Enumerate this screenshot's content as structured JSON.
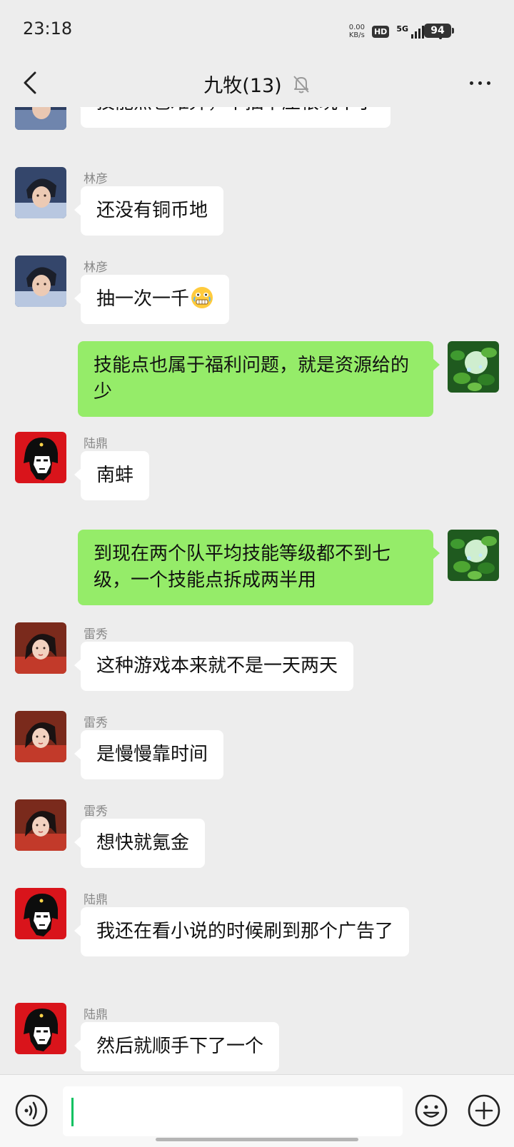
{
  "status_bar": {
    "time": "23:18",
    "net_speed_value": "0.00",
    "net_speed_unit": "KB/s",
    "hd": "HD",
    "network": "5G",
    "battery": "94"
  },
  "nav": {
    "title": "九牧(13)",
    "muted": true
  },
  "messages": [
    {
      "direction": "in",
      "sender": "",
      "avatar": "anime-boy-avatar",
      "text": "技能点也难弄，不抽卡压根玩不了"
    },
    {
      "direction": "in",
      "sender": "林彦",
      "avatar": "anime-boy-avatar",
      "text": "还没有铜币地"
    },
    {
      "direction": "in",
      "sender": "林彦",
      "avatar": "anime-boy-avatar",
      "text": "抽一次一千",
      "emoji": "grimace-tears-emoji"
    },
    {
      "direction": "out",
      "sender": "",
      "avatar": "green-leaves-avatar",
      "text": "技能点也属于福利问题，就是资源给的少"
    },
    {
      "direction": "in",
      "sender": "陆鼎",
      "avatar": "che-portrait-avatar",
      "text": "南蚌"
    },
    {
      "direction": "out",
      "sender": "",
      "avatar": "green-leaves-avatar",
      "text": "到现在两个队平均技能等级都不到七级，一个技能点拆成两半用"
    },
    {
      "direction": "in",
      "sender": "雷秀",
      "avatar": "red-robe-avatar",
      "text": "这种游戏本来就不是一天两天"
    },
    {
      "direction": "in",
      "sender": "雷秀",
      "avatar": "red-robe-avatar",
      "text": "是慢慢靠时间"
    },
    {
      "direction": "in",
      "sender": "雷秀",
      "avatar": "red-robe-avatar",
      "text": "想快就氪金"
    },
    {
      "direction": "in",
      "sender": "陆鼎",
      "avatar": "che-portrait-avatar",
      "text": "我还在看小说的时候刷到那个广告了"
    },
    {
      "direction": "in",
      "sender": "陆鼎",
      "avatar": "che-portrait-avatar",
      "text": "然后就顺手下了一个"
    }
  ],
  "input": {
    "value": "",
    "placeholder": ""
  },
  "colors": {
    "background": "#ededed",
    "outgoing_bubble": "#95ec69",
    "incoming_bubble": "#ffffff",
    "caret": "#07c160"
  }
}
